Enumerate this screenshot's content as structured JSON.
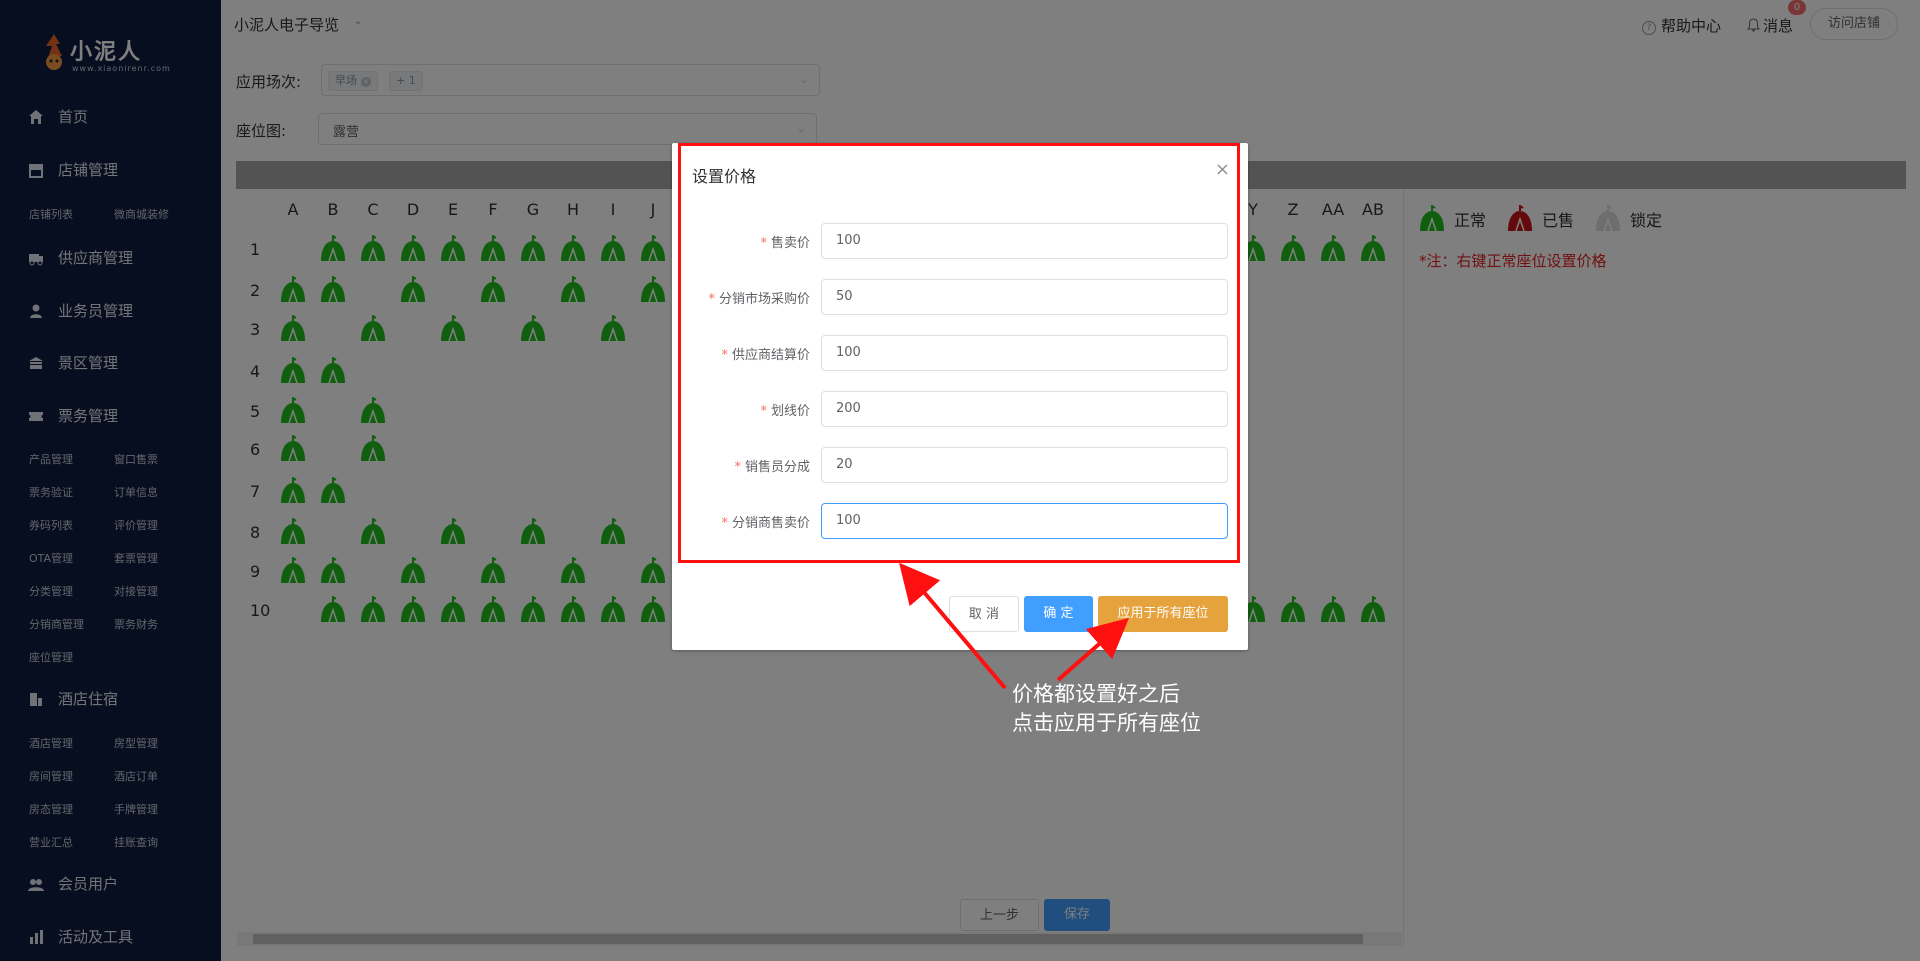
{
  "logo": {
    "name": "小泥人",
    "url": "www.xiaonirenr.com"
  },
  "sidebar": {
    "main": [
      {
        "label": "首页",
        "icon": "home-icon"
      },
      {
        "label": "店铺管理",
        "icon": "shop-icon"
      },
      {
        "label": "供应商管理",
        "icon": "supplier-icon"
      },
      {
        "label": "业务员管理",
        "icon": "user-icon"
      },
      {
        "label": "景区管理",
        "icon": "scenic-icon"
      },
      {
        "label": "票务管理",
        "icon": "ticket-icon"
      },
      {
        "label": "酒店住宿",
        "icon": "hotel-icon"
      },
      {
        "label": "会员用户",
        "icon": "member-icon"
      },
      {
        "label": "活动及工具",
        "icon": "chart-icon"
      }
    ],
    "sub_shop": [
      "店铺列表",
      "微商城装修"
    ],
    "sub_ticket": [
      "产品管理",
      "窗口售票",
      "票务验证",
      "订单信息",
      "券码列表",
      "评价管理",
      "OTA管理",
      "套票管理",
      "分类管理",
      "对接管理",
      "分销商管理",
      "票务财务",
      "座位管理"
    ],
    "sub_hotel": [
      "酒店管理",
      "房型管理",
      "房间管理",
      "酒店订单",
      "房态管理",
      "手牌管理",
      "营业汇总",
      "挂账查询"
    ]
  },
  "topbar": {
    "store_name": "小泥人电子导览",
    "help": "帮助中心",
    "message": "消息",
    "message_count": "0",
    "visit": "访问店铺"
  },
  "form": {
    "scene_label": "应用场次:",
    "scene_tag": "早场",
    "scene_more": "+ 1",
    "seatmap_label": "座位图:",
    "seatmap_value": "露营"
  },
  "grid": {
    "columns_left": [
      "A",
      "B",
      "C",
      "D",
      "E",
      "F",
      "G",
      "H",
      "I",
      "J"
    ],
    "columns_right": [
      "Y",
      "Z",
      "AA",
      "AB"
    ],
    "rows": [
      "1",
      "2",
      "3",
      "4",
      "5",
      "6",
      "7",
      "8",
      "9",
      "10"
    ]
  },
  "legend": {
    "normal": "正常",
    "sold": "已售",
    "locked": "锁定",
    "note": "*注：右键正常座位设置价格"
  },
  "bottom": {
    "prev": "上一步",
    "save": "保存"
  },
  "dialog": {
    "title": "设置价格",
    "fields": [
      {
        "label": "售卖价",
        "value": "100"
      },
      {
        "label": "分销市场采购价",
        "value": "50"
      },
      {
        "label": "供应商结算价",
        "value": "100"
      },
      {
        "label": "划线价",
        "value": "200"
      },
      {
        "label": "销售员分成",
        "value": "20"
      },
      {
        "label": "分销商售卖价",
        "value": "100"
      }
    ],
    "cancel": "取 消",
    "confirm": "确 定",
    "apply_all": "应用于所有座位"
  },
  "annotation": {
    "line1": "价格都设置好之后",
    "line2": "点击应用于所有座位"
  },
  "colors": {
    "sidebar": "#0f1c3f",
    "seat_green": "#1fbf1f",
    "primary": "#409eff",
    "warning": "#e6a23c",
    "highlight": "#ff1010"
  }
}
